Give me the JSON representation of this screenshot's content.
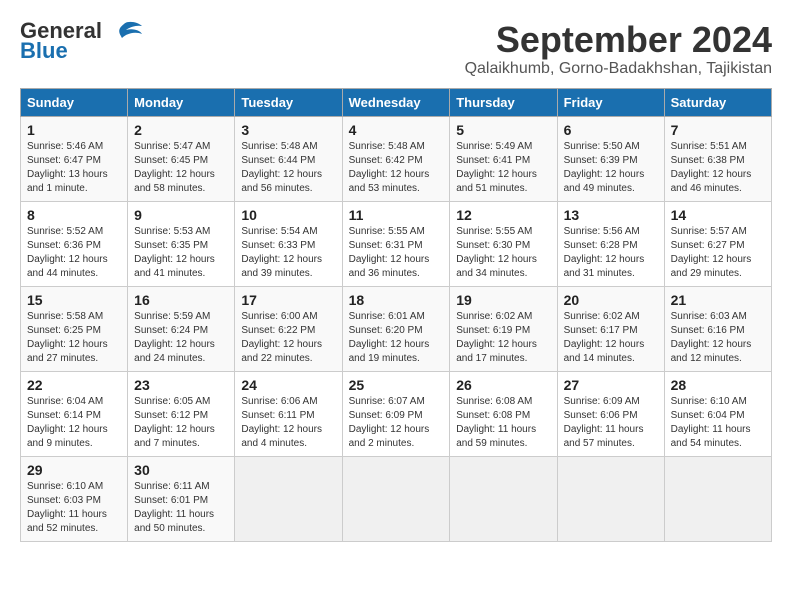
{
  "header": {
    "logo_general": "General",
    "logo_blue": "Blue",
    "month_title": "September 2024",
    "location": "Qalaikhumb, Gorno-Badakhshan, Tajikistan"
  },
  "weekdays": [
    "Sunday",
    "Monday",
    "Tuesday",
    "Wednesday",
    "Thursday",
    "Friday",
    "Saturday"
  ],
  "weeks": [
    [
      {
        "day": "1",
        "info": "Sunrise: 5:46 AM\nSunset: 6:47 PM\nDaylight: 13 hours\nand 1 minute."
      },
      {
        "day": "2",
        "info": "Sunrise: 5:47 AM\nSunset: 6:45 PM\nDaylight: 12 hours\nand 58 minutes."
      },
      {
        "day": "3",
        "info": "Sunrise: 5:48 AM\nSunset: 6:44 PM\nDaylight: 12 hours\nand 56 minutes."
      },
      {
        "day": "4",
        "info": "Sunrise: 5:48 AM\nSunset: 6:42 PM\nDaylight: 12 hours\nand 53 minutes."
      },
      {
        "day": "5",
        "info": "Sunrise: 5:49 AM\nSunset: 6:41 PM\nDaylight: 12 hours\nand 51 minutes."
      },
      {
        "day": "6",
        "info": "Sunrise: 5:50 AM\nSunset: 6:39 PM\nDaylight: 12 hours\nand 49 minutes."
      },
      {
        "day": "7",
        "info": "Sunrise: 5:51 AM\nSunset: 6:38 PM\nDaylight: 12 hours\nand 46 minutes."
      }
    ],
    [
      {
        "day": "8",
        "info": "Sunrise: 5:52 AM\nSunset: 6:36 PM\nDaylight: 12 hours\nand 44 minutes."
      },
      {
        "day": "9",
        "info": "Sunrise: 5:53 AM\nSunset: 6:35 PM\nDaylight: 12 hours\nand 41 minutes."
      },
      {
        "day": "10",
        "info": "Sunrise: 5:54 AM\nSunset: 6:33 PM\nDaylight: 12 hours\nand 39 minutes."
      },
      {
        "day": "11",
        "info": "Sunrise: 5:55 AM\nSunset: 6:31 PM\nDaylight: 12 hours\nand 36 minutes."
      },
      {
        "day": "12",
        "info": "Sunrise: 5:55 AM\nSunset: 6:30 PM\nDaylight: 12 hours\nand 34 minutes."
      },
      {
        "day": "13",
        "info": "Sunrise: 5:56 AM\nSunset: 6:28 PM\nDaylight: 12 hours\nand 31 minutes."
      },
      {
        "day": "14",
        "info": "Sunrise: 5:57 AM\nSunset: 6:27 PM\nDaylight: 12 hours\nand 29 minutes."
      }
    ],
    [
      {
        "day": "15",
        "info": "Sunrise: 5:58 AM\nSunset: 6:25 PM\nDaylight: 12 hours\nand 27 minutes."
      },
      {
        "day": "16",
        "info": "Sunrise: 5:59 AM\nSunset: 6:24 PM\nDaylight: 12 hours\nand 24 minutes."
      },
      {
        "day": "17",
        "info": "Sunrise: 6:00 AM\nSunset: 6:22 PM\nDaylight: 12 hours\nand 22 minutes."
      },
      {
        "day": "18",
        "info": "Sunrise: 6:01 AM\nSunset: 6:20 PM\nDaylight: 12 hours\nand 19 minutes."
      },
      {
        "day": "19",
        "info": "Sunrise: 6:02 AM\nSunset: 6:19 PM\nDaylight: 12 hours\nand 17 minutes."
      },
      {
        "day": "20",
        "info": "Sunrise: 6:02 AM\nSunset: 6:17 PM\nDaylight: 12 hours\nand 14 minutes."
      },
      {
        "day": "21",
        "info": "Sunrise: 6:03 AM\nSunset: 6:16 PM\nDaylight: 12 hours\nand 12 minutes."
      }
    ],
    [
      {
        "day": "22",
        "info": "Sunrise: 6:04 AM\nSunset: 6:14 PM\nDaylight: 12 hours\nand 9 minutes."
      },
      {
        "day": "23",
        "info": "Sunrise: 6:05 AM\nSunset: 6:12 PM\nDaylight: 12 hours\nand 7 minutes."
      },
      {
        "day": "24",
        "info": "Sunrise: 6:06 AM\nSunset: 6:11 PM\nDaylight: 12 hours\nand 4 minutes."
      },
      {
        "day": "25",
        "info": "Sunrise: 6:07 AM\nSunset: 6:09 PM\nDaylight: 12 hours\nand 2 minutes."
      },
      {
        "day": "26",
        "info": "Sunrise: 6:08 AM\nSunset: 6:08 PM\nDaylight: 11 hours\nand 59 minutes."
      },
      {
        "day": "27",
        "info": "Sunrise: 6:09 AM\nSunset: 6:06 PM\nDaylight: 11 hours\nand 57 minutes."
      },
      {
        "day": "28",
        "info": "Sunrise: 6:10 AM\nSunset: 6:04 PM\nDaylight: 11 hours\nand 54 minutes."
      }
    ],
    [
      {
        "day": "29",
        "info": "Sunrise: 6:10 AM\nSunset: 6:03 PM\nDaylight: 11 hours\nand 52 minutes."
      },
      {
        "day": "30",
        "info": "Sunrise: 6:11 AM\nSunset: 6:01 PM\nDaylight: 11 hours\nand 50 minutes."
      },
      {
        "day": "",
        "info": ""
      },
      {
        "day": "",
        "info": ""
      },
      {
        "day": "",
        "info": ""
      },
      {
        "day": "",
        "info": ""
      },
      {
        "day": "",
        "info": ""
      }
    ]
  ]
}
